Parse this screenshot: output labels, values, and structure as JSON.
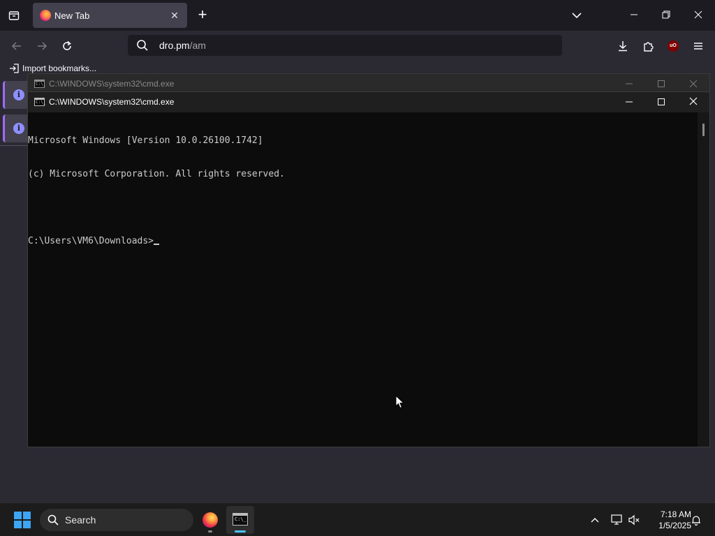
{
  "browser": {
    "tab": {
      "title": "New Tab"
    },
    "url": {
      "host": "dro.pm",
      "path": "/am"
    },
    "bookmarks": {
      "import_label": "Import bookmarks..."
    },
    "colors": {
      "accent": "#a06bff",
      "toolbar": "#2b2a33",
      "tabbar": "#1c1b22"
    }
  },
  "cmd_background": {
    "title": "C:\\WINDOWS\\system32\\cmd.exe"
  },
  "cmd": {
    "title": "C:\\WINDOWS\\system32\\cmd.exe",
    "icon_label": "C:\\_",
    "lines": [
      "Microsoft Windows [Version 10.0.26100.1742]",
      "(c) Microsoft Corporation. All rights reserved.",
      "",
      "C:\\Users\\VM6\\Downloads>"
    ]
  },
  "taskbar": {
    "search_label": "Search",
    "clock_time": "7:18 AM",
    "clock_date": "1/5/2025",
    "ublock_label": "uO",
    "info_glyph": "i",
    "term_glyph": "C:\\_"
  }
}
